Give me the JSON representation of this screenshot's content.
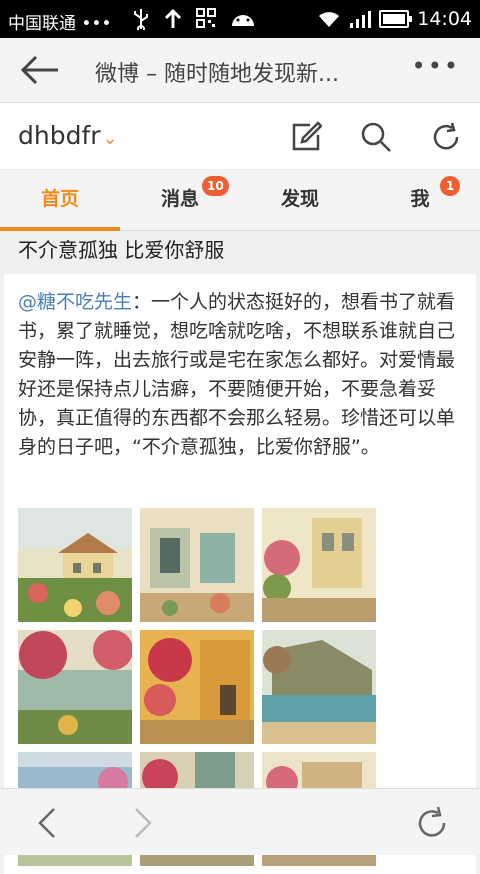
{
  "status_bar": {
    "carrier": "中国联通",
    "dots": "•••",
    "time": "14:04"
  },
  "browser": {
    "page_title": "微博 – 随时随地发现新...",
    "more": "•••"
  },
  "weibo_header": {
    "username": "dhbdfr",
    "caret": "⌄"
  },
  "tabs": [
    {
      "label": "首页",
      "badge": ""
    },
    {
      "label": "消息",
      "badge": "10"
    },
    {
      "label": "发现",
      "badge": ""
    },
    {
      "label": "我",
      "badge": "1"
    }
  ],
  "post": {
    "heading": "不介意孤独 比爱你舒服",
    "mention": "@糖不吃先生",
    "text": "：一个人的状态挺好的，想看书了就看书，累了就睡觉，想吃啥就吃啥，不想联系谁就自己安静一阵，出去旅行或是宅在家怎么都好。对爱情最好还是保持点儿洁癖，不要随便开始，不要急着妥协，真正值得的东西都不会那么轻易。珍惜还可以单身的日子吧，“不介意孤独，比爱你舒服”。"
  },
  "colors": {
    "accent": "#f28a1a",
    "badge": "#f05d2e",
    "link": "#4a7fb5"
  }
}
